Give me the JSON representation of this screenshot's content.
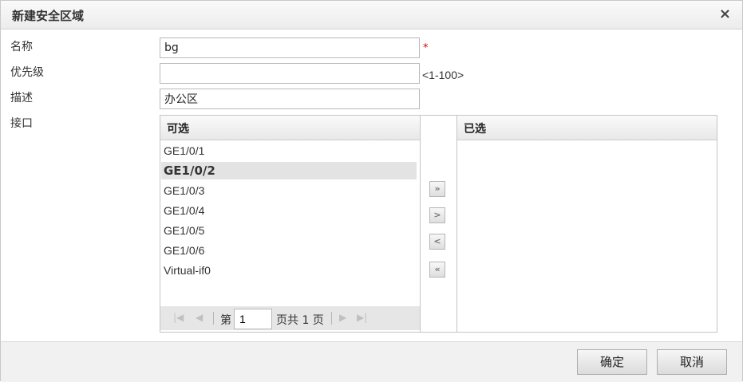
{
  "dialog": {
    "title": "新建安全区域",
    "close_glyph": "×"
  },
  "form": {
    "name_label": "名称",
    "name_value": "bg",
    "required_mark": "*",
    "priority_label": "优先级",
    "priority_value": "",
    "priority_hint": "<1-100>",
    "desc_label": "描述",
    "desc_value": "办公区",
    "interface_label": "接口"
  },
  "available": {
    "header": "可选",
    "items": [
      "GE1/0/1",
      "GE1/0/2",
      "GE1/0/3",
      "GE1/0/4",
      "GE1/0/5",
      "GE1/0/6",
      "Virtual-if0"
    ],
    "selected_item": "GE1/0/2"
  },
  "selected": {
    "header": "已选",
    "items": []
  },
  "transfer": {
    "add_all": "»",
    "add": ">",
    "remove": "<",
    "remove_all": "«"
  },
  "pager": {
    "first": "|◀",
    "prev": "◀",
    "page_prefix": "第",
    "page_value": "1",
    "page_suffix": "页共 1 页",
    "next": "▶",
    "last": "▶|"
  },
  "footer": {
    "ok": "确定",
    "cancel": "取消"
  }
}
